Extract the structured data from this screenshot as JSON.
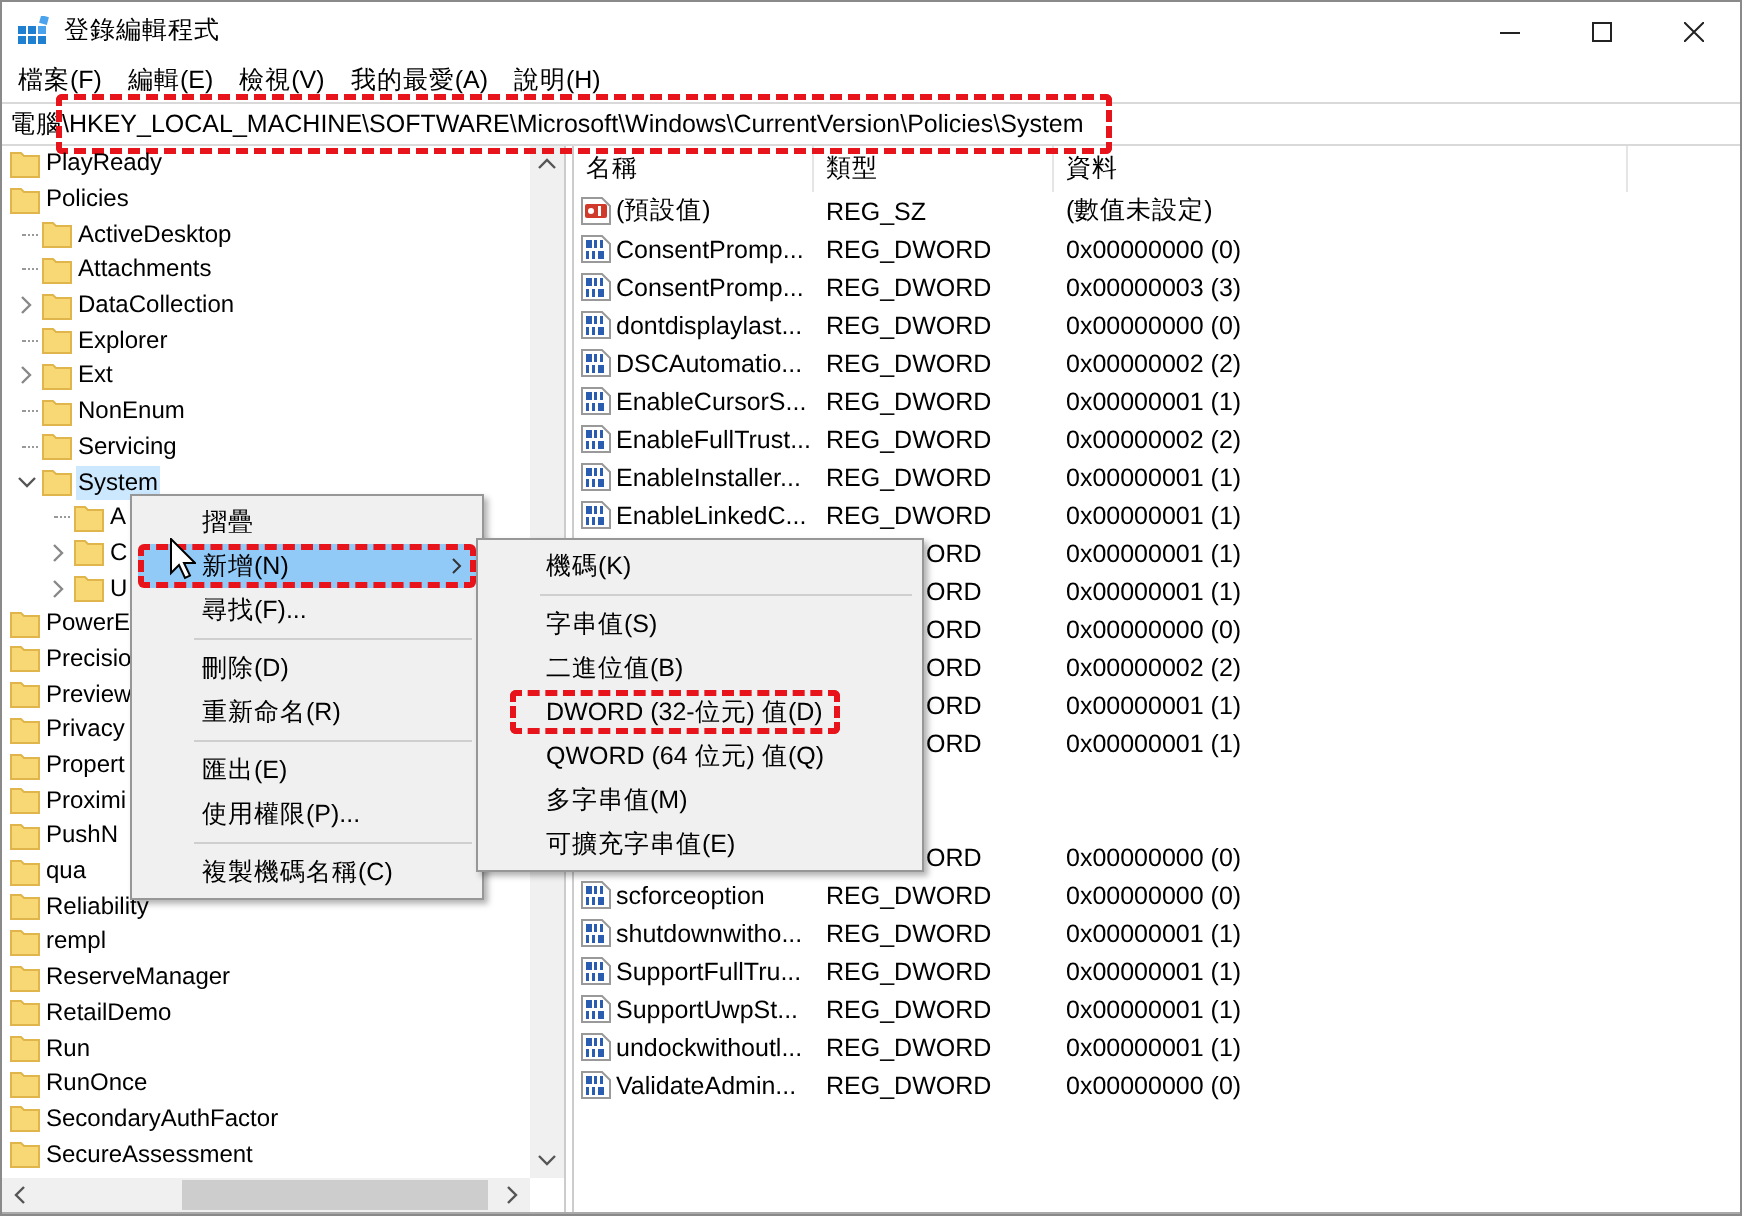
{
  "window": {
    "title": "登錄編輯程式"
  },
  "menu_bar": [
    "檔案(F)",
    "編輯(E)",
    "檢視(V)",
    "我的最愛(A)",
    "說明(H)"
  ],
  "address": {
    "path": "電腦\\HKEY_LOCAL_MACHINE\\SOFTWARE\\Microsoft\\Windows\\CurrentVersion\\Policies\\System",
    "highlighted": true
  },
  "tree": {
    "items": [
      {
        "label": "PlayReady",
        "selected": false
      },
      {
        "label": "Policies",
        "selected": false,
        "children": [
          {
            "label": "ActiveDesktop",
            "expandable": false,
            "selected": false
          },
          {
            "label": "Attachments",
            "expandable": false,
            "selected": false
          },
          {
            "label": "DataCollection",
            "expandable": true,
            "selected": false
          },
          {
            "label": "Explorer",
            "expandable": false,
            "selected": false
          },
          {
            "label": "Ext",
            "expandable": true,
            "selected": false
          },
          {
            "label": "NonEnum",
            "expandable": false,
            "selected": false
          },
          {
            "label": "Servicing",
            "expandable": false,
            "selected": false
          },
          {
            "label": "System",
            "expandable": true,
            "selected": true,
            "children": [
              {
                "label": "A",
                "expandable": false,
                "selected": false
              },
              {
                "label": "C",
                "expandable": true,
                "selected": false
              },
              {
                "label": "U",
                "expandable": true,
                "selected": false
              }
            ]
          }
        ]
      },
      {
        "label": "PowerE",
        "selected": false
      },
      {
        "label": "Precisio",
        "selected": false
      },
      {
        "label": "Preview",
        "selected": false
      },
      {
        "label": "Privacy",
        "selected": false
      },
      {
        "label": "Propert",
        "selected": false
      },
      {
        "label": "Proximi",
        "selected": false
      },
      {
        "label": "PushN",
        "selected": false
      },
      {
        "label": "qua",
        "selected": false
      },
      {
        "label": "Reliability",
        "selected": false
      },
      {
        "label": "rempl",
        "selected": false
      },
      {
        "label": "ReserveManager",
        "selected": false
      },
      {
        "label": "RetailDemo",
        "selected": false
      },
      {
        "label": "Run",
        "selected": false
      },
      {
        "label": "RunOnce",
        "selected": false
      },
      {
        "label": "SecondaryAuthFactor",
        "selected": false
      },
      {
        "label": "SecureAssessment",
        "selected": false
      }
    ]
  },
  "list": {
    "columns": [
      "名稱",
      "類型",
      "資料"
    ],
    "rows": [
      {
        "kind": "string",
        "name": "(預設值)",
        "type": "REG_SZ",
        "data": "(數值未設定)"
      },
      {
        "kind": "dword",
        "name": "ConsentPromp...",
        "type": "REG_DWORD",
        "data": "0x00000000 (0)"
      },
      {
        "kind": "dword",
        "name": "ConsentPromp...",
        "type": "REG_DWORD",
        "data": "0x00000003 (3)"
      },
      {
        "kind": "dword",
        "name": "dontdisplaylast...",
        "type": "REG_DWORD",
        "data": "0x00000000 (0)"
      },
      {
        "kind": "dword",
        "name": "DSCAutomatio...",
        "type": "REG_DWORD",
        "data": "0x00000002 (2)"
      },
      {
        "kind": "dword",
        "name": "EnableCursorS...",
        "type": "REG_DWORD",
        "data": "0x00000001 (1)"
      },
      {
        "kind": "dword",
        "name": "EnableFullTrust...",
        "type": "REG_DWORD",
        "data": "0x00000002 (2)"
      },
      {
        "kind": "dword",
        "name": "EnableInstaller...",
        "type": "REG_DWORD",
        "data": "0x00000001 (1)"
      },
      {
        "kind": "dword",
        "name": "EnableLinkedC...",
        "type": "REG_DWORD",
        "data": "0x00000001 (1)"
      },
      {
        "kind": "covered",
        "type": "ORD",
        "data": "0x00000001 (1)"
      },
      {
        "kind": "covered",
        "type": "ORD",
        "data": "0x00000001 (1)"
      },
      {
        "kind": "covered",
        "type": "ORD",
        "data": "0x00000000 (0)"
      },
      {
        "kind": "covered",
        "type": "ORD",
        "data": "0x00000002 (2)"
      },
      {
        "kind": "covered",
        "type": "ORD",
        "data": "0x00000001 (1)"
      },
      {
        "kind": "covered",
        "type": "ORD",
        "data": "0x00000001 (1)"
      },
      {
        "kind": "hidden"
      },
      {
        "kind": "hidden"
      },
      {
        "kind": "covered",
        "type": "ORD",
        "data": "0x00000000 (0)"
      },
      {
        "kind": "dword",
        "name": "scforceoption",
        "type": "REG_DWORD",
        "data": "0x00000000 (0)"
      },
      {
        "kind": "dword",
        "name": "shutdownwitho...",
        "type": "REG_DWORD",
        "data": "0x00000001 (1)"
      },
      {
        "kind": "dword",
        "name": "SupportFullTru...",
        "type": "REG_DWORD",
        "data": "0x00000001 (1)"
      },
      {
        "kind": "dword",
        "name": "SupportUwpSt...",
        "type": "REG_DWORD",
        "data": "0x00000001 (1)"
      },
      {
        "kind": "dword",
        "name": "undockwithoutl...",
        "type": "REG_DWORD",
        "data": "0x00000001 (1)"
      },
      {
        "kind": "dword",
        "name": "ValidateAdmin...",
        "type": "REG_DWORD",
        "data": "0x00000000 (0)"
      }
    ]
  },
  "context_menu": {
    "items": [
      {
        "kind": "item",
        "label": "摺疊",
        "selected": false,
        "highlighted": false,
        "submenu": false
      },
      {
        "kind": "item",
        "label": "新增(N)",
        "selected": true,
        "highlighted": true,
        "submenu": true
      },
      {
        "kind": "item",
        "label": "尋找(F)...",
        "selected": false,
        "highlighted": false,
        "submenu": false
      },
      {
        "kind": "separator"
      },
      {
        "kind": "item",
        "label": "刪除(D)",
        "selected": false,
        "highlighted": false,
        "submenu": false
      },
      {
        "kind": "item",
        "label": "重新命名(R)",
        "selected": false,
        "highlighted": false,
        "submenu": false
      },
      {
        "kind": "separator"
      },
      {
        "kind": "item",
        "label": "匯出(E)",
        "selected": false,
        "highlighted": false,
        "submenu": false
      },
      {
        "kind": "item",
        "label": "使用權限(P)...",
        "selected": false,
        "highlighted": false,
        "submenu": false
      },
      {
        "kind": "separator"
      },
      {
        "kind": "item",
        "label": "複製機碼名稱(C)",
        "selected": false,
        "highlighted": false,
        "submenu": false
      }
    ]
  },
  "submenu": {
    "items": [
      {
        "kind": "item",
        "label": "機碼(K)",
        "selected": false,
        "highlighted": false,
        "submenu": false
      },
      {
        "kind": "separator"
      },
      {
        "kind": "item",
        "label": "字串值(S)",
        "selected": false,
        "highlighted": false,
        "submenu": false
      },
      {
        "kind": "item",
        "label": "二進位值(B)",
        "selected": false,
        "highlighted": false,
        "submenu": false
      },
      {
        "kind": "item",
        "label": "DWORD (32-位元) 值(D)",
        "selected": false,
        "highlighted": true,
        "submenu": false
      },
      {
        "kind": "item",
        "label": "QWORD (64 位元) 值(Q)",
        "selected": false,
        "highlighted": false,
        "submenu": false
      },
      {
        "kind": "item",
        "label": "多字串值(M)",
        "selected": false,
        "highlighted": false,
        "submenu": false
      },
      {
        "kind": "item",
        "label": "可擴充字串值(E)",
        "selected": false,
        "highlighted": false,
        "submenu": false
      }
    ]
  }
}
